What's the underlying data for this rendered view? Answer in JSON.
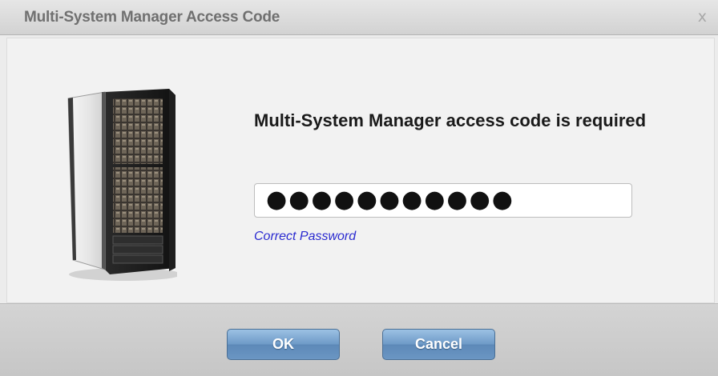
{
  "dialog": {
    "title": "Multi-System Manager Access Code",
    "close_label": "x"
  },
  "content": {
    "heading": "Multi-System Manager access code is required",
    "password_value": "●●●●●●●●●●●",
    "status_text": "Correct Password",
    "image_icon": "server-rack-icon"
  },
  "buttons": {
    "ok_label": "OK",
    "cancel_label": "Cancel"
  },
  "colors": {
    "button_blue": "#6f9bc8",
    "status_link": "#2a2ad0",
    "title_text": "#707070"
  }
}
